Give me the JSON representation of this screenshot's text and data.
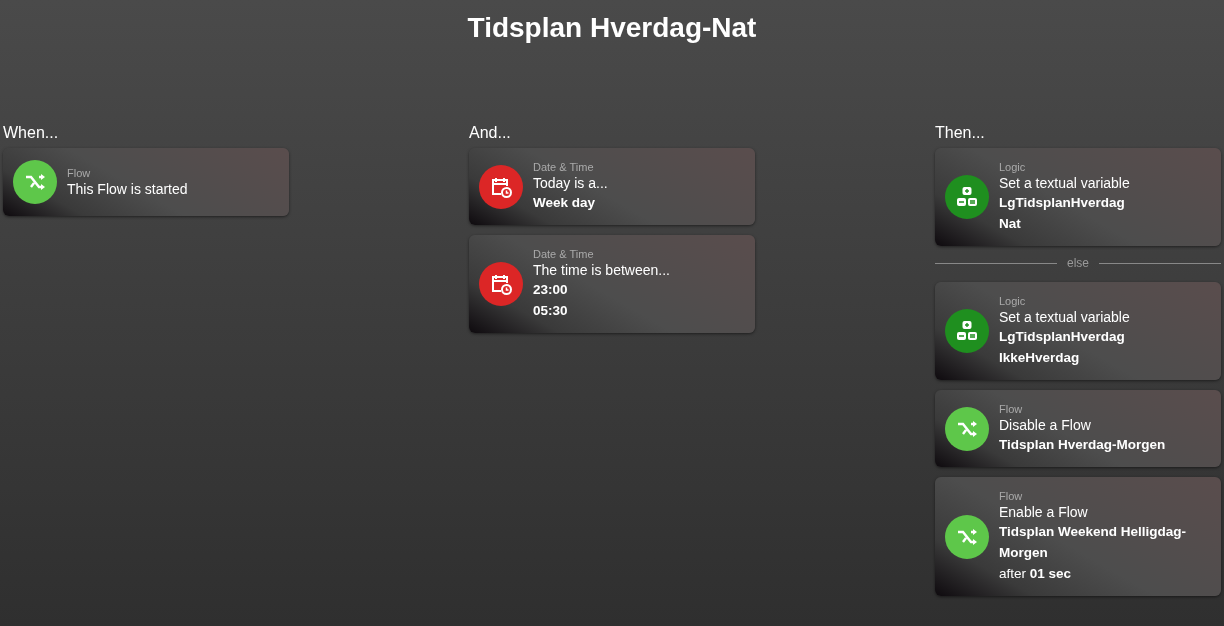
{
  "title": "Tidsplan Hverdag-Nat",
  "columns": [
    {
      "heading": "When...",
      "cards": [
        {
          "kind": "flow",
          "color": "#5ec74a",
          "category": "Flow",
          "title": "This Flow is started"
        }
      ]
    },
    {
      "heading": "And...",
      "cards": [
        {
          "kind": "datetime",
          "color": "#dc2626",
          "category": "Date & Time",
          "title": "Today is a...",
          "args": [
            "Week day"
          ]
        },
        {
          "kind": "datetime",
          "color": "#dc2626",
          "category": "Date & Time",
          "title": "The time is between...",
          "args": [
            "23:00",
            "05:30"
          ]
        }
      ]
    },
    {
      "heading": "Then...",
      "cards": [
        {
          "kind": "logic",
          "color": "#1f8f1f",
          "category": "Logic",
          "title": "Set a textual variable",
          "args": [
            "LgTidsplanHverdag",
            "Nat"
          ]
        }
      ],
      "else_label": "else",
      "else_cards": [
        {
          "kind": "logic",
          "color": "#1f8f1f",
          "category": "Logic",
          "title": "Set a textual variable",
          "args": [
            "LgTidsplanHverdag",
            "IkkeHverdag"
          ]
        },
        {
          "kind": "flow",
          "color": "#5ec74a",
          "category": "Flow",
          "title": "Disable a Flow",
          "args": [
            "Tidsplan Hverdag-Morgen"
          ]
        },
        {
          "kind": "flow",
          "color": "#5ec74a",
          "category": "Flow",
          "title": "Enable a Flow",
          "args": [
            "Tidsplan Weekend Helligdag-Morgen"
          ],
          "delay": "after **01 sec**"
        }
      ]
    }
  ]
}
